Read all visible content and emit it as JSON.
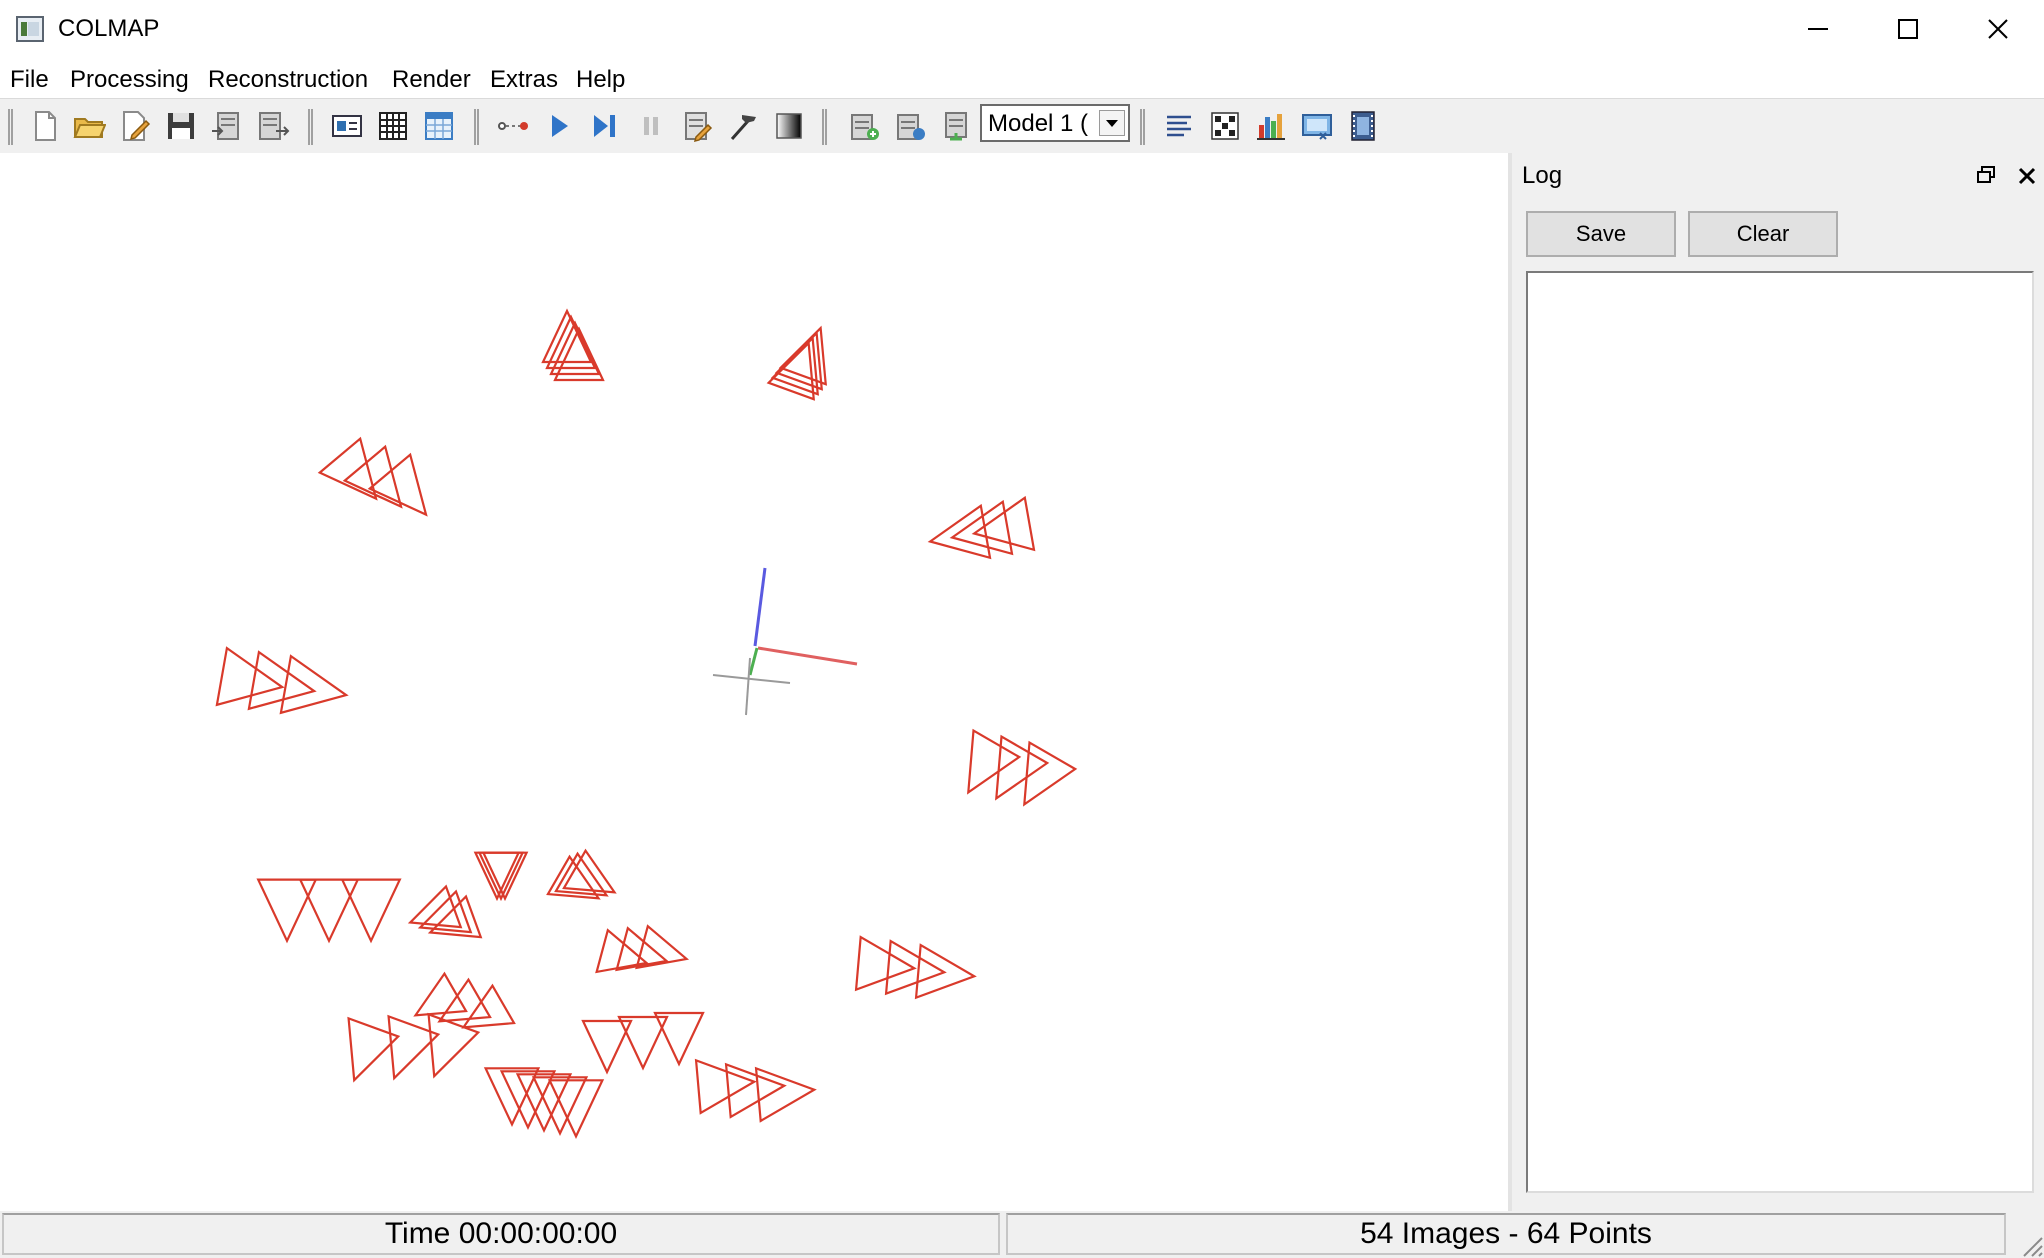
{
  "window": {
    "title": "COLMAP",
    "controls": [
      "minimize",
      "maximize",
      "close"
    ]
  },
  "menubar": {
    "items": [
      "File",
      "Processing",
      "Reconstruction",
      "Render",
      "Extras",
      "Help"
    ]
  },
  "toolbar": {
    "icons": [
      "new-project-icon",
      "open-project-icon",
      "edit-project-icon",
      "save-project-icon",
      "import-model-icon",
      "export-model-icon",
      "feature-extraction-icon",
      "feature-matching-icon",
      "database-management-icon",
      "automatic-reconstruction-icon",
      "start-reconstruction-icon",
      "step-reconstruction-icon",
      "pause-reconstruction-icon",
      "reconstruction-options-icon",
      "bundle-adjustment-icon",
      "dense-reconstruction-icon",
      "render-toggle-icon",
      "render-now-icon",
      "render-options-icon",
      "reconstruction-stats-icon",
      "match-matrix-icon",
      "model-statistics-icon",
      "grab-image-icon",
      "grab-movie-icon"
    ],
    "model_selector": {
      "value": "Model 1 ("
    }
  },
  "viewer": {
    "camera_color": "#d93a2b",
    "axis_colors": {
      "x": "#e06060",
      "y": "#4caf50",
      "z": "#5a5ae0"
    }
  },
  "log_panel": {
    "title": "Log",
    "save_label": "Save",
    "clear_label": "Clear",
    "content": ""
  },
  "statusbar": {
    "time_text": "Time 00:00:00:00",
    "stats_text": "54 Images - 64 Points"
  }
}
